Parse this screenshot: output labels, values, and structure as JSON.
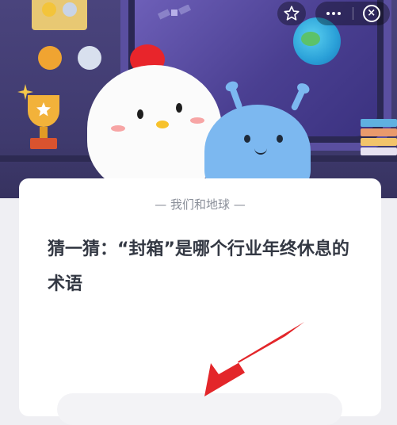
{
  "hero": {
    "scene": "character-illustration",
    "accent_color": "#4a447d"
  },
  "nav": {
    "favorite_icon": "star-outline-icon",
    "more_icon": "more-dots-icon",
    "close_icon": "close-circle-icon"
  },
  "card": {
    "subtitle": "— 我们和地球 —",
    "question": "猜一猜：“封箱”是哪个行业年终休息的术语"
  },
  "overlay": {
    "arrow_color": "#e3262a"
  }
}
